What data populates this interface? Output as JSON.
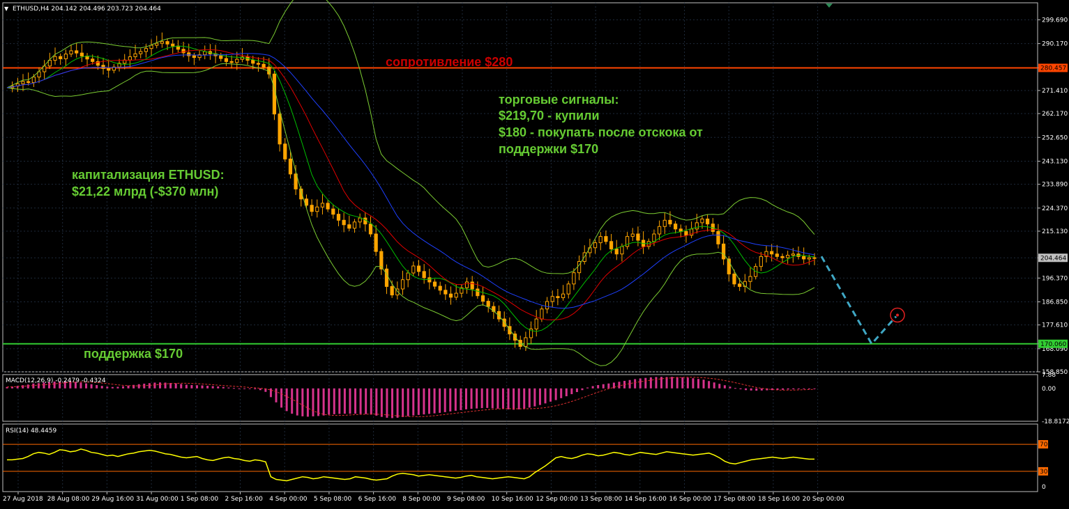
{
  "colors": {
    "background": "#000000",
    "grid": "#1e2a3a",
    "frame": "#c0c0c0",
    "candle": "#ffa500",
    "resistance": "#ff4500",
    "support": "#32cd32",
    "bollinger": "#7ccd32",
    "ma_fast": "#00c000",
    "ma_mid": "#e00000",
    "ma_slow": "#1e40ff",
    "macd_hist": "#d6338c",
    "macd_signal": "#e03030",
    "rsi": "#ffff00",
    "rsi_levels": "#ff6a00",
    "forecast": "#3fa7c4",
    "target_circle": "#e02020",
    "annotation_green": "#66cc33",
    "annotation_red": "#cc0000"
  },
  "header": {
    "symbol_info": "ETHUSD,H4  204.142 204.496 203.723 204.464"
  },
  "annotations": {
    "resistance_text": "сопротивление $280",
    "signals_title": "торговые сигналы:",
    "signals_line1": "$219,70 - купили",
    "signals_line2": "$180 - покупать после отскока от",
    "signals_line3": "поддержки $170",
    "cap_title": "капитализация ETHUSD:",
    "cap_value": "$21,22 млрд (-$370 млн)",
    "support_text": "поддержка $170"
  },
  "indicators": {
    "macd_label": "MACD(12,26,9) -0.2479 -0.4324",
    "rsi_label": "RSI(14) 48.4459"
  },
  "chart_data": [
    {
      "type": "candlestick",
      "panel": "price",
      "symbol": "ETHUSD",
      "timeframe": "H4",
      "ylim": [
        158.85,
        306.5
      ],
      "y_ticks": [
        "299.690",
        "290.170",
        "280.457",
        "271.410",
        "262.170",
        "252.650",
        "243.130",
        "233.890",
        "224.370",
        "215.130",
        "204.464",
        "196.370",
        "186.850",
        "177.610",
        "170.060",
        "168.090",
        "158.850"
      ],
      "price_markers": [
        {
          "label": "280.457",
          "value": 280.457,
          "color": "#ff4500"
        },
        {
          "label": "204.464",
          "value": 204.464,
          "color": "#c0c0c0"
        },
        {
          "label": "170.060",
          "value": 170.06,
          "color": "#32cd32"
        }
      ],
      "time_labels": [
        "27 Aug 2018",
        "28 Aug 08:00",
        "29 Aug 16:00",
        "31 Aug 00:00",
        "1 Sep 08:00",
        "2 Sep 16:00",
        "4 Sep 00:00",
        "5 Sep 08:00",
        "6 Sep 16:00",
        "8 Sep 00:00",
        "9 Sep 08:00",
        "10 Sep 16:00",
        "12 Sep 00:00",
        "13 Sep 08:00",
        "14 Sep 16:00",
        "16 Sep 00:00",
        "17 Sep 08:00",
        "18 Sep 16:00",
        "20 Sep 00:00"
      ],
      "horizontal_lines": [
        {
          "name": "resistance",
          "value": 280.457
        },
        {
          "name": "support",
          "value": 170.06
        }
      ],
      "close_path": [
        272.5,
        273.2,
        274.1,
        275.0,
        274.6,
        276.8,
        278.9,
        281.2,
        283.5,
        285.0,
        284.1,
        286.0,
        287.3,
        286.4,
        285.2,
        284.0,
        283.0,
        281.5,
        280.2,
        279.5,
        280.8,
        282.3,
        283.6,
        284.9,
        286.1,
        287.0,
        288.2,
        289.5,
        290.3,
        291.0,
        290.0,
        289.2,
        287.9,
        286.5,
        285.3,
        284.6,
        285.7,
        287.0,
        286.1,
        285.3,
        284.2,
        283.0,
        282.6,
        283.9,
        284.8,
        283.5,
        282.3,
        281.9,
        280.8,
        278.0,
        262.0,
        250.0,
        244.0,
        238.0,
        232.0,
        228.0,
        225.5,
        223.0,
        224.8,
        226.3,
        224.0,
        221.9,
        219.5,
        217.7,
        216.3,
        218.8,
        220.4,
        218.0,
        214.0,
        207.0,
        200.0,
        193.0,
        189.6,
        192.0,
        195.7,
        198.4,
        201.2,
        199.0,
        196.5,
        194.8,
        193.1,
        191.5,
        190.0,
        188.7,
        190.3,
        192.5,
        194.8,
        192.0,
        189.3,
        187.1,
        185.0,
        183.0,
        180.0,
        177.0,
        174.0,
        171.5,
        169.0,
        172.5,
        176.0,
        180.0,
        184.0,
        187.0,
        189.0,
        188.5,
        190.0,
        194.0,
        198.5,
        203.0,
        206.5,
        208.5,
        210.5,
        213.0,
        211.0,
        208.0,
        206.0,
        209.0,
        213.0,
        214.0,
        211.5,
        209.0,
        211.0,
        214.0,
        217.0,
        219.5,
        218.0,
        216.0,
        215.0,
        213.5,
        216.0,
        218.5,
        220.0,
        218.0,
        215.0,
        210.0,
        204.0,
        198.0,
        194.0,
        193.0,
        195.0,
        197.0,
        201.0,
        205.0,
        207.0,
        206.0,
        205.0,
        204.5,
        205.5,
        206.0,
        205.0,
        204.0,
        204.5,
        204.5
      ]
    },
    {
      "type": "histogram",
      "panel": "macd",
      "name": "MACD(12,26,9)",
      "values": {
        "main": -0.2479,
        "signal": -0.4324
      },
      "y_ticks": [
        "7.88",
        "0.00",
        "-18.8172"
      ],
      "ylim": [
        -18.8172,
        7.88
      ],
      "bars": [
        0.8,
        1.0,
        1.4,
        1.8,
        2.2,
        2.8,
        3.0,
        3.4,
        3.6,
        3.9,
        4.0,
        4.1,
        4.0,
        3.7,
        3.3,
        2.9,
        2.4,
        1.9,
        1.4,
        1.0,
        0.8,
        0.9,
        1.2,
        1.6,
        2.0,
        2.4,
        2.7,
        3.0,
        3.3,
        3.4,
        3.3,
        3.1,
        2.9,
        2.5,
        2.1,
        1.9,
        1.8,
        1.7,
        1.5,
        1.3,
        1.1,
        0.8,
        0.5,
        0.2,
        0.0,
        -0.1,
        -0.3,
        -0.5,
        -1.0,
        -2.0,
        -5.0,
        -8.0,
        -11.0,
        -13.0,
        -14.5,
        -15.5,
        -16.0,
        -16.2,
        -16.0,
        -15.8,
        -15.5,
        -15.0,
        -14.8,
        -14.6,
        -14.5,
        -14.5,
        -14.5,
        -14.6,
        -14.7,
        -15.0,
        -15.6,
        -16.3,
        -16.8,
        -17.0,
        -16.8,
        -16.4,
        -15.9,
        -15.5,
        -15.2,
        -14.9,
        -14.6,
        -14.3,
        -14.0,
        -13.6,
        -13.2,
        -12.8,
        -12.4,
        -12.0,
        -11.7,
        -11.5,
        -11.3,
        -11.2,
        -11.4,
        -11.6,
        -11.8,
        -12.0,
        -12.2,
        -12.0,
        -11.6,
        -11.0,
        -10.3,
        -9.5,
        -8.6,
        -7.6,
        -6.7,
        -5.6,
        -4.5,
        -3.3,
        -2.1,
        -1.0,
        0.5,
        1.3,
        1.9,
        2.4,
        2.8,
        3.3,
        3.8,
        4.3,
        4.8,
        5.3,
        5.7,
        6.0,
        6.3,
        6.5,
        6.6,
        6.5,
        6.6,
        6.5,
        6.3,
        6.1,
        5.8,
        5.4,
        5.0,
        4.2,
        3.4,
        2.6,
        1.8,
        1.0,
        0.2,
        -0.5,
        -1.0,
        -1.2,
        -1.3,
        -1.2,
        -1.1,
        -1.0,
        -0.9,
        -0.8,
        -0.6,
        -0.5,
        -0.4,
        -0.3,
        -0.25,
        -0.2
      ]
    },
    {
      "type": "line",
      "panel": "rsi",
      "name": "RSI(14)",
      "value": 48.4459,
      "ylim": [
        0,
        100
      ],
      "levels": [
        70,
        30
      ],
      "y_ticks": [
        "70",
        "30",
        "0"
      ],
      "values": [
        47,
        47,
        48,
        49,
        52,
        56,
        58,
        57,
        55,
        58,
        62,
        61,
        59,
        60,
        63,
        61,
        58,
        57,
        55,
        53,
        54,
        52,
        54,
        56,
        57,
        59,
        60,
        61,
        60,
        58,
        56,
        55,
        53,
        51,
        50,
        51,
        52,
        49,
        47,
        46,
        48,
        50,
        51,
        49,
        48,
        46,
        45,
        47,
        46,
        44,
        22,
        18,
        17,
        16,
        18,
        20,
        22,
        21,
        19,
        20,
        22,
        21,
        20,
        19,
        18,
        19,
        22,
        21,
        20,
        18,
        17,
        18,
        19,
        23,
        26,
        27,
        26,
        25,
        23,
        24,
        25,
        24,
        23,
        22,
        21,
        20,
        21,
        23,
        24,
        22,
        21,
        20,
        19,
        20,
        21,
        22,
        21,
        20,
        19,
        22,
        28,
        33,
        38,
        44,
        50,
        52,
        50,
        49,
        51,
        54,
        56,
        55,
        53,
        54,
        56,
        58,
        57,
        55,
        54,
        56,
        58,
        57,
        56,
        55,
        57,
        59,
        58,
        57,
        56,
        55,
        54,
        55,
        56,
        57,
        54,
        50,
        45,
        42,
        41,
        43,
        45,
        47,
        48,
        49,
        50,
        51,
        50,
        49,
        50,
        51,
        50,
        49,
        48,
        48
      ]
    }
  ],
  "forecast": {
    "points": [
      [
        205.0,
        0
      ],
      [
        170.06,
        1
      ],
      [
        181.0,
        2
      ]
    ]
  }
}
